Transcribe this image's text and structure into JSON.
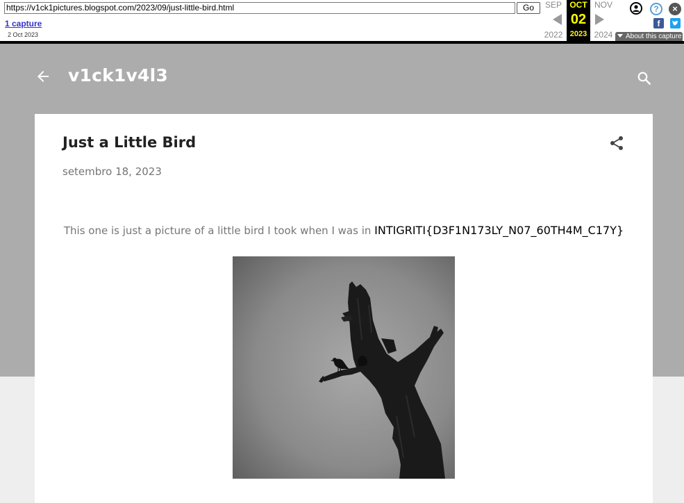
{
  "wayback": {
    "url": "https://v1ck1pictures.blogspot.com/2023/09/just-little-bird.html",
    "go_label": "Go",
    "captures_label": "1 capture",
    "capture_date": "2 Oct 2023",
    "prev_month": "SEP",
    "prev_year": "2022",
    "current_month": "OCT",
    "current_day": "02",
    "current_year": "2023",
    "next_month": "NOV",
    "next_year": "2024",
    "about_label": "About this capture",
    "icons": [
      "user-icon",
      "help-icon",
      "close-icon",
      "facebook-icon",
      "twitter-icon"
    ],
    "highlight_color": "#ffff00"
  },
  "blog": {
    "title": "v1ck1v4l3",
    "header_color": "#acacac"
  },
  "post": {
    "title": "Just a Little Bird",
    "date": "setembro 18, 2023",
    "body_text": "This one is just a picture of a little bird I took when I was in ",
    "flag_text": "INTIGRITI{D3F1N173LY_N07_60TH4M_C17Y}",
    "image_description_icon": "bird-on-tree-photo"
  }
}
